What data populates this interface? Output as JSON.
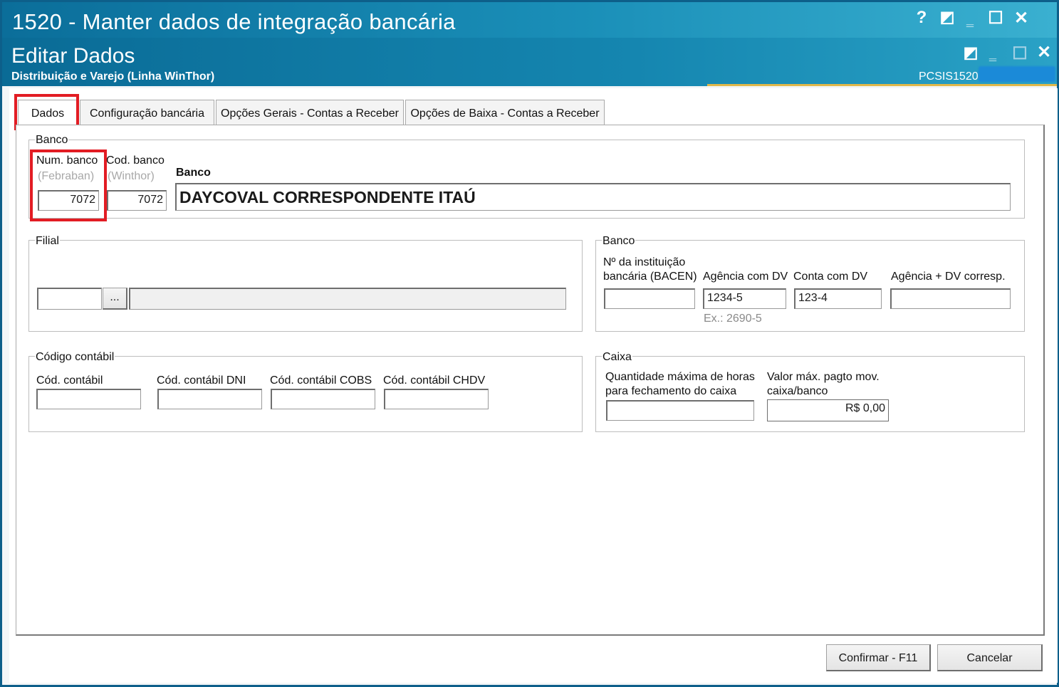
{
  "window": {
    "title": "1520 - Manter dados de integração bancária",
    "controls": [
      "?",
      "◩",
      "‗",
      "☐",
      "✕"
    ]
  },
  "form": {
    "title": "Editar Dados",
    "subtitle": "Distribuição e Varejo (Linha WinThor)",
    "code": "PCSIS1520"
  },
  "tabs": [
    {
      "label": "Dados",
      "active": true
    },
    {
      "label": "Configuração bancária",
      "active": false
    },
    {
      "label": "Opções Gerais - Contas a Receber",
      "active": false
    },
    {
      "label": "Opções de Baixa - Contas a Receber",
      "active": false
    }
  ],
  "banco_top": {
    "group_label": "Banco",
    "num_banco_label": "Num. banco",
    "num_banco_sub": "(Febraban)",
    "num_banco_value": "7072",
    "cod_banco_label": "Cod. banco",
    "cod_banco_sub": "(Winthor)",
    "cod_banco_value": "7072",
    "banco_label": "Banco",
    "banco_value": "DAYCOVAL  CORRESPONDENTE ITAÚ"
  },
  "filial": {
    "group_label": "Filial",
    "code_value": "",
    "browse_label": "...",
    "name_value": ""
  },
  "banco_right": {
    "group_label": "Banco",
    "bacen_label_1": "Nº da instituição",
    "bacen_label_2": "bancária (BACEN)",
    "bacen_value": "",
    "agencia_label": "Agência com DV",
    "agencia_value": "1234-5",
    "agencia_hint": "Ex.: 2690-5",
    "conta_label": "Conta com DV",
    "conta_value": "123-4",
    "agencia_corresp_label": "Agência + DV corresp.",
    "agencia_corresp_value": ""
  },
  "codigo_contabil": {
    "group_label": "Código contábil",
    "fields": [
      {
        "label": "Cód. contábil",
        "value": ""
      },
      {
        "label": "Cód. contábil DNI",
        "value": ""
      },
      {
        "label": "Cód. contábil COBS",
        "value": ""
      },
      {
        "label": "Cód. contábil CHDV",
        "value": ""
      }
    ]
  },
  "caixa": {
    "group_label": "Caixa",
    "horas_label_1": "Quantidade máxima de horas",
    "horas_label_2": "para fechamento do caixa",
    "horas_value": "",
    "valor_label_1": "Valor máx. pagto mov.",
    "valor_label_2": "caixa/banco",
    "valor_value": "R$ 0,00"
  },
  "buttons": {
    "confirm": "Confirmar - F11",
    "cancel": "Cancelar"
  },
  "colors": {
    "titlebar": "#0b6e9a",
    "highlight": "#e21c23"
  }
}
